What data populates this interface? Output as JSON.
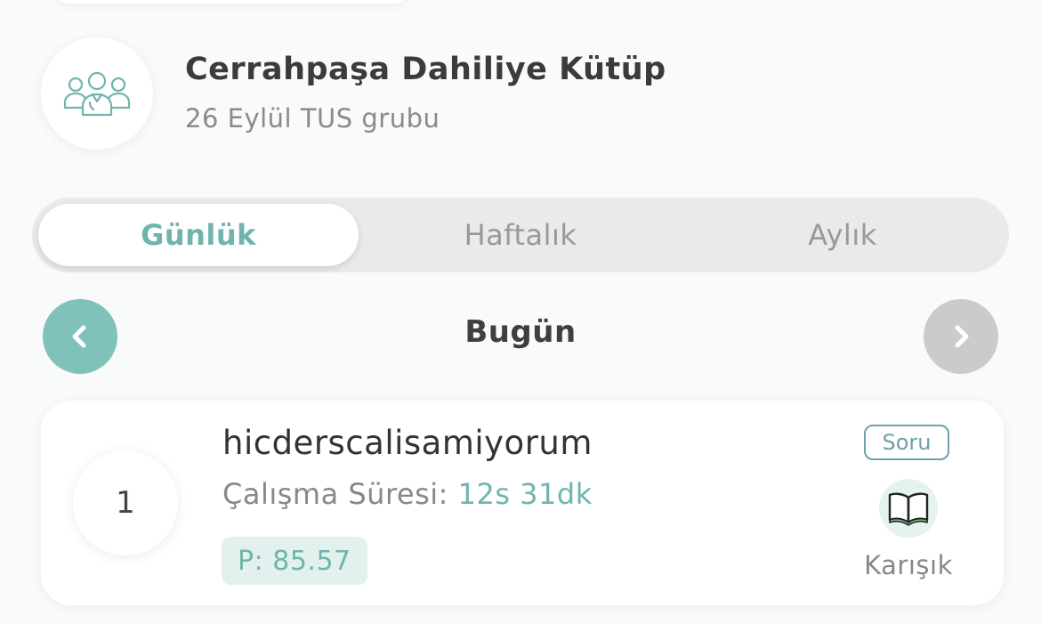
{
  "group": {
    "name": "Cerrahpaşa Dahiliye Kütüp",
    "subtitle": "26 Eylül TUS grubu",
    "icon": "group-people-icon"
  },
  "period_tabs": {
    "items": [
      {
        "label": "Günlük",
        "active": true
      },
      {
        "label": "Haftalık",
        "active": false
      },
      {
        "label": "Aylık",
        "active": false
      }
    ]
  },
  "date_nav": {
    "label": "Bugün",
    "prev_icon": "chevron-left-icon",
    "next_icon": "chevron-right-icon",
    "prev_enabled": true,
    "next_enabled": false
  },
  "leaderboard": [
    {
      "rank": "1",
      "username": "hicderscalisamiyorum",
      "study_label": "Çalışma Süresi:",
      "study_value": "12s 31dk",
      "points": "P: 85.57",
      "tag": "Soru",
      "category": "Karışık",
      "category_icon": "open-book-icon"
    }
  ],
  "colors": {
    "accent": "#6fb5ad",
    "accent_button": "#80c2b9",
    "disabled": "#cbcbcb",
    "tag": "#6fa0ab",
    "badge_bg": "#e3f1ee"
  }
}
